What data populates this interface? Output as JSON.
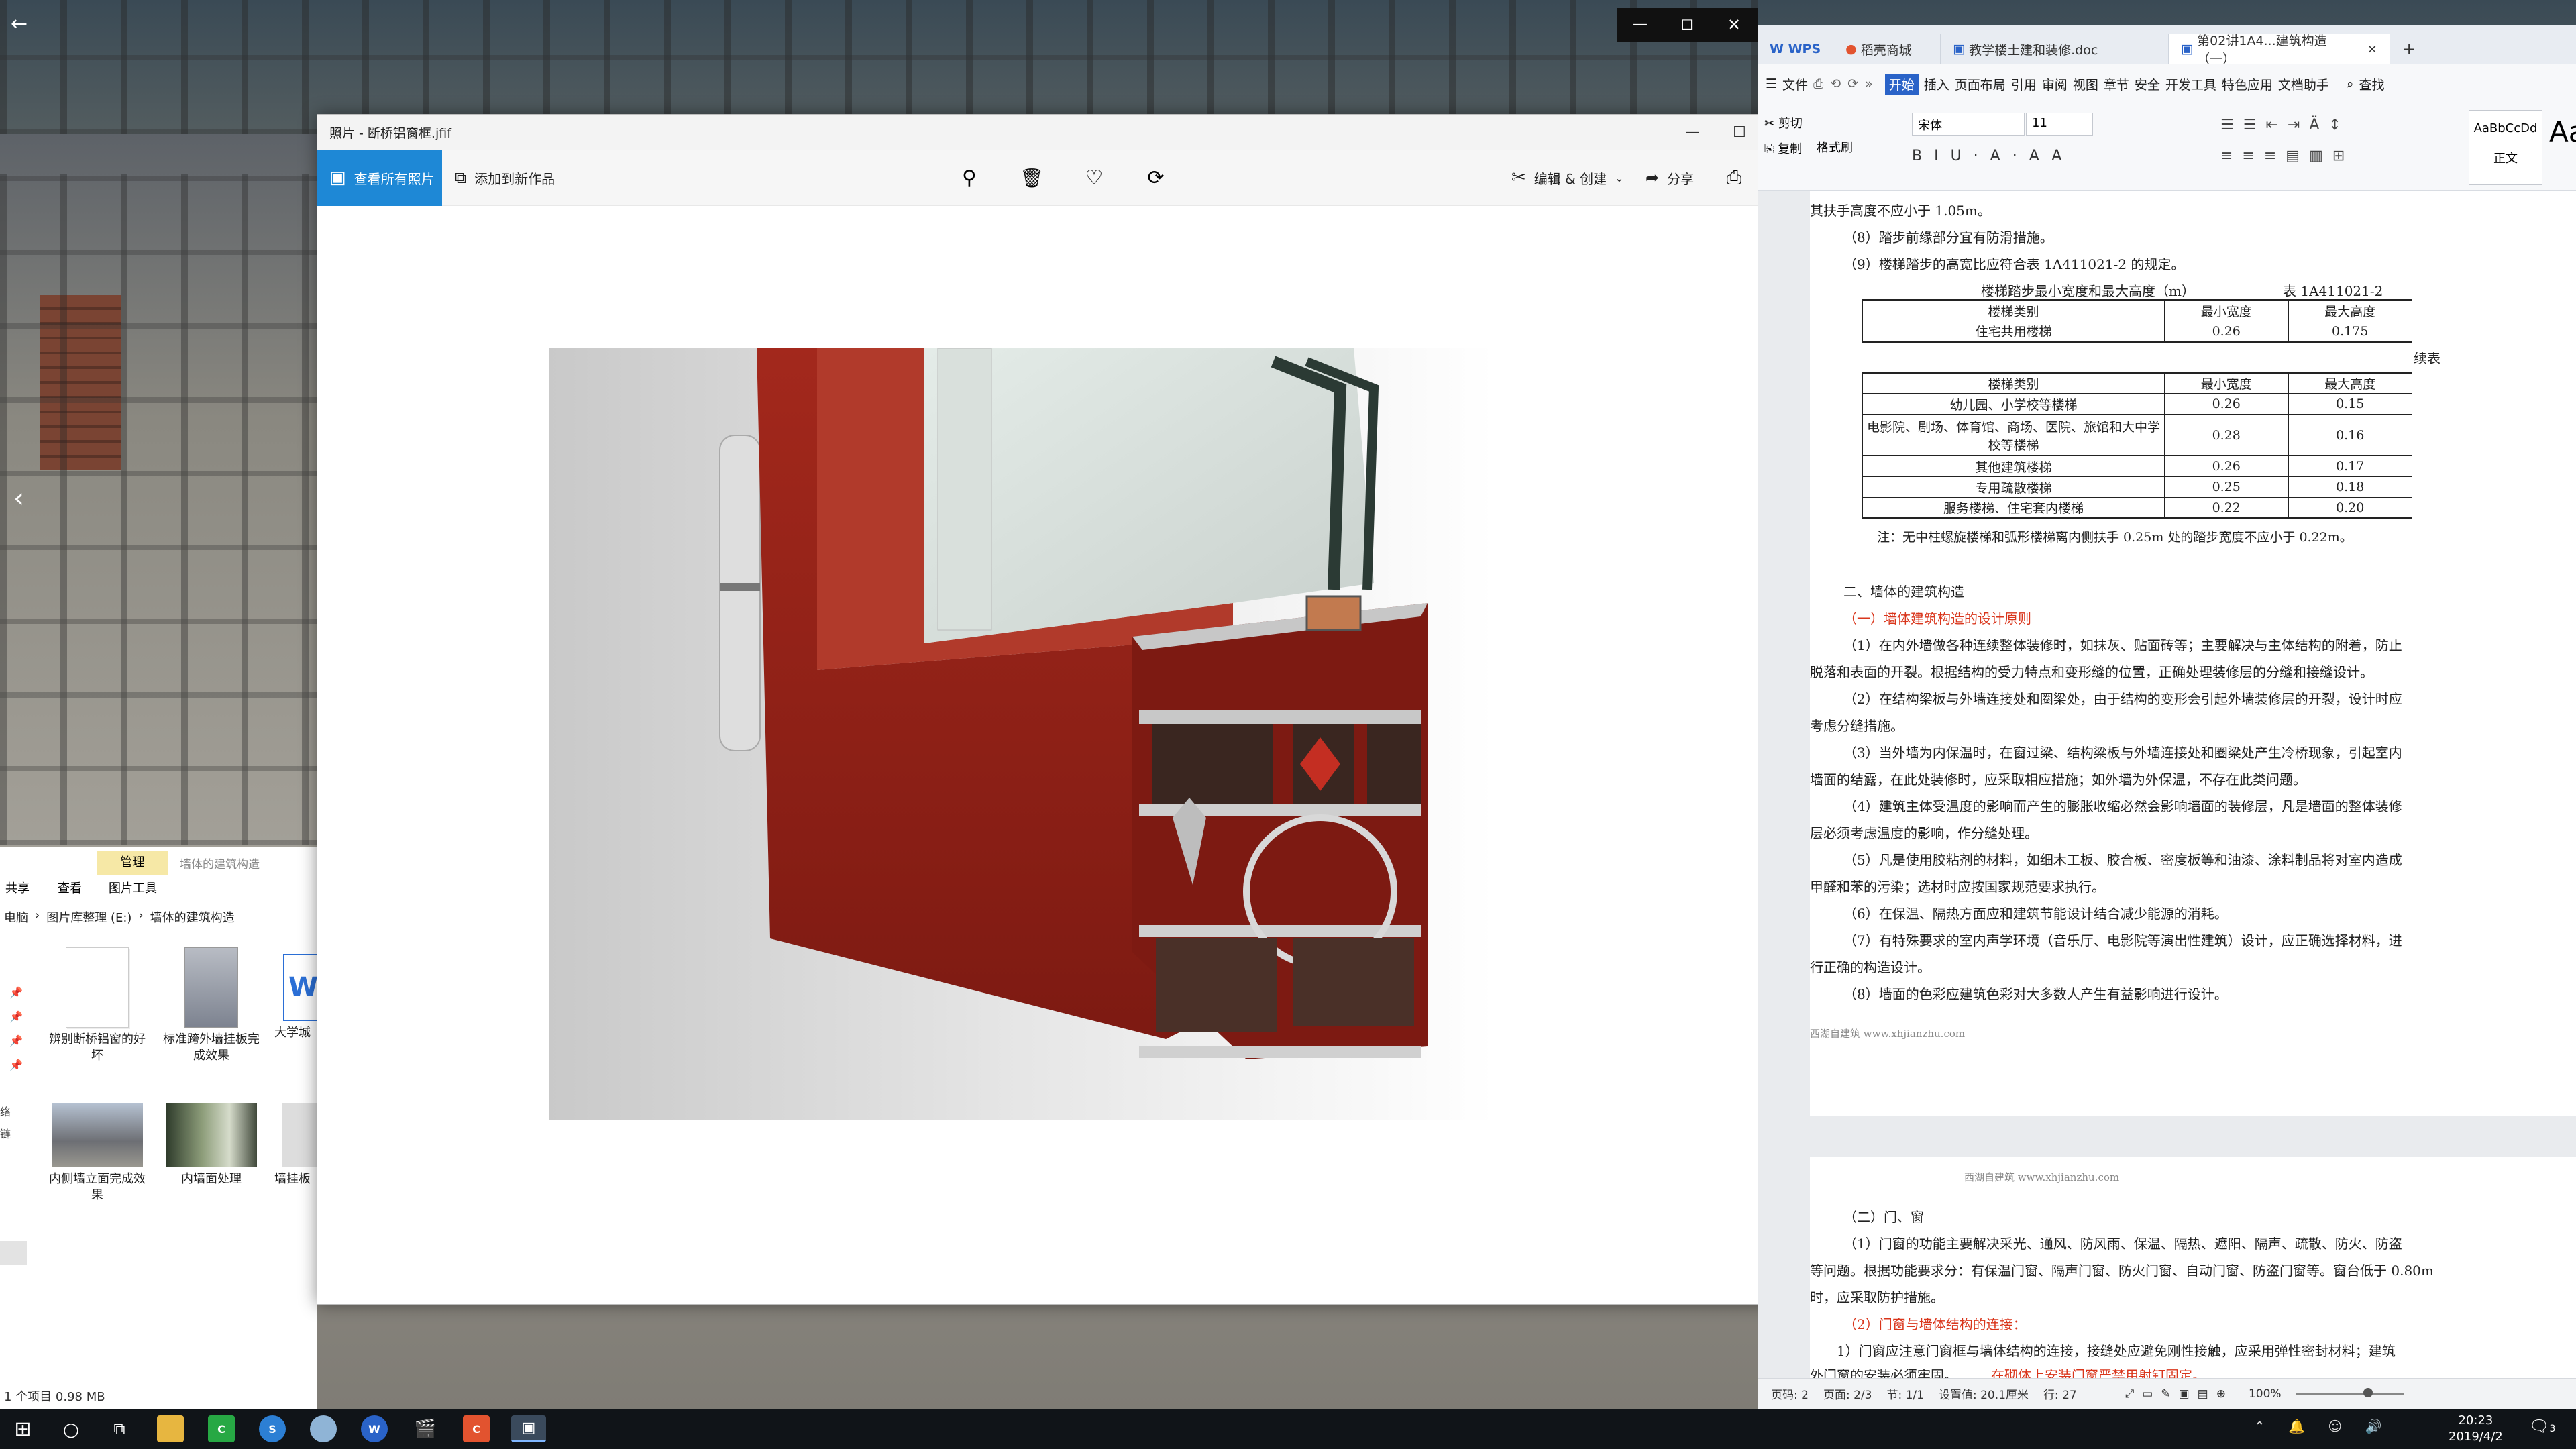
{
  "photo_viewer": {
    "title": "照片 - 断桥铝窗框.jfif",
    "see_all": "查看所有照片",
    "add_to": "添加到新作品",
    "edit_create": "编辑 & 创建",
    "share": "分享",
    "more": "···"
  },
  "explorer": {
    "ribbon_tab_manage": "管理",
    "ribbon_folder_label": "墙体的建筑构造",
    "menu_share": "共享",
    "menu_view": "查看",
    "menu_picture_tools": "图片工具",
    "breadcrumb": [
      "电脑",
      "图片库整理 (E:)",
      "墙体的建筑构造"
    ],
    "items": [
      {
        "label": "辨别断桥铝窗的好坏",
        "icon": "document-icon"
      },
      {
        "label": "标准跨外墙挂板完成效果",
        "icon": "image-icon"
      },
      {
        "label": "大学城",
        "icon": "word-icon"
      },
      {
        "label": "内侧墙立面完成效果",
        "icon": "image-icon"
      },
      {
        "label": "内墙面处理",
        "icon": "image-icon"
      },
      {
        "label": "墙挂板",
        "icon": "image-icon"
      }
    ],
    "left_pane_labels": [
      "络",
      "链"
    ],
    "status": "1 个项目  0.98 MB"
  },
  "wps": {
    "tabs": [
      "WPS",
      "稻壳商城",
      "教学楼土建和装修.doc",
      "第02讲1A4...建筑构造（一）"
    ],
    "menu": [
      "文件",
      "开始",
      "插入",
      "页面布局",
      "引用",
      "审阅",
      "视图",
      "章节",
      "安全",
      "开发工具",
      "特色应用",
      "文档助手"
    ],
    "search": "查找",
    "font_name": "宋体",
    "font_size": "11",
    "clipboard": [
      "剪切",
      "复制",
      "格式刷"
    ],
    "style_preview": "AaBbCcDd",
    "style_name": "正文",
    "style_big": "Aa",
    "doc": {
      "p1": "其扶手高度不应小于 1.05m。",
      "p2": "（8）踏步前缘部分宜有防滑措施。",
      "p3": "（9）楼梯踏步的高宽比应符合表 1A411021-2 的规定。",
      "table_caption": "楼梯踏步最小宽度和最大高度（m）",
      "table_no": "表 1A411021-2",
      "table_headers": [
        "楼梯类别",
        "最小宽度",
        "最大高度"
      ],
      "table1_rows": [
        [
          "住宅共用楼梯",
          "0.26",
          "0.175"
        ]
      ],
      "continued": "续表",
      "table2_rows": [
        [
          "幼儿园、小学校等楼梯",
          "0.26",
          "0.15"
        ],
        [
          "电影院、剧场、体育馆、商场、医院、旅馆和大中学校等楼梯",
          "0.28",
          "0.16"
        ],
        [
          "其他建筑楼梯",
          "0.26",
          "0.17"
        ],
        [
          "专用疏散楼梯",
          "0.25",
          "0.18"
        ],
        [
          "服务楼梯、住宅套内楼梯",
          "0.22",
          "0.20"
        ]
      ],
      "note": "注：无中柱螺旋楼梯和弧形楼梯离内侧扶手 0.25m 处的踏步宽度不应小于 0.22m。",
      "h2": "二、墙体的建筑构造",
      "h3": "（一）墙体建筑构造的设计原则",
      "w1a": "（1）在内外墙做各种连续整体装修时，如抹灰、贴面砖等；主要解决与主体结构的附着，防止",
      "w1b": "脱落和表面的开裂。根据结构的受力特点和变形缝的位置，正确处理装修层的分缝和接缝设计。",
      "w2a": "（2）在结构梁板与外墙连接处和圈梁处，由于结构的变形会引起外墙装修层的开裂，设计时应",
      "w2b": "考虑分缝措施。",
      "w3a": "（3）当外墙为内保温时，在窗过梁、结构梁板与外墙连接处和圈梁处产生冷桥现象，引起室内",
      "w3b": "墙面的结露，在此处装修时，应采取相应措施；如外墙为外保温，不存在此类问题。",
      "w4a": "（4）建筑主体受温度的影响而产生的膨胀收缩必然会影响墙面的装修层，凡是墙面的整体装修",
      "w4b": "层必须考虑温度的影响，作分缝处理。",
      "w5a": "（5）凡是使用胶粘剂的材料，如细木工板、胶合板、密度板等和油漆、涂料制品将对室内造成",
      "w5b": "甲醛和苯的污染；选材时应按国家规范要求执行。",
      "w6": "（6）在保温、隔热方面应和建筑节能设计结合减少能源的消耗。",
      "w7a": "（7）有特殊要求的室内声学环境（音乐厅、电影院等演出性建筑）设计，应正确选择材料，进",
      "w7b": "行正确的构造设计。",
      "w8": "（8）墙面的色彩应建筑色彩对大多数人产生有益影响进行设计。",
      "footer": "西湖自建筑  www.xhjianzhu.com",
      "header2": "西湖自建筑  www.xhjianzhu.com",
      "d1": "（二）门、窗",
      "d2a": "（1）门窗的功能主要解决采光、通风、防风雨、保温、隔热、遮阳、隔声、疏散、防火、防盗",
      "d2b": "等问题。根据功能要求分：有保温门窗、隔声门窗、防火门窗、自动门窗、防盗门窗等。窗台低于 0.80m",
      "d2c": "时，应采取防护措施。",
      "d3": "（2）门窗与墙体结构的连接：",
      "d4a": "1）门窗应注意门窗框与墙体结构的连接，接缝处应避免刚性接触，应采用弹性密封材料；建筑",
      "d4b": "外门窗的安装必须牢固。",
      "d4c": "在砌体上安装门窗严禁用射钉固定。"
    },
    "status": {
      "page": "页码: 2",
      "pages": "页面: 2/3",
      "section": "节: 1/1",
      "setting": "设置值: 20.1厘米",
      "row": "行: 27",
      "zoom": "100%"
    }
  },
  "taskbar": {
    "time": "20:23",
    "date": "2019/4/2",
    "notifications": "3"
  }
}
